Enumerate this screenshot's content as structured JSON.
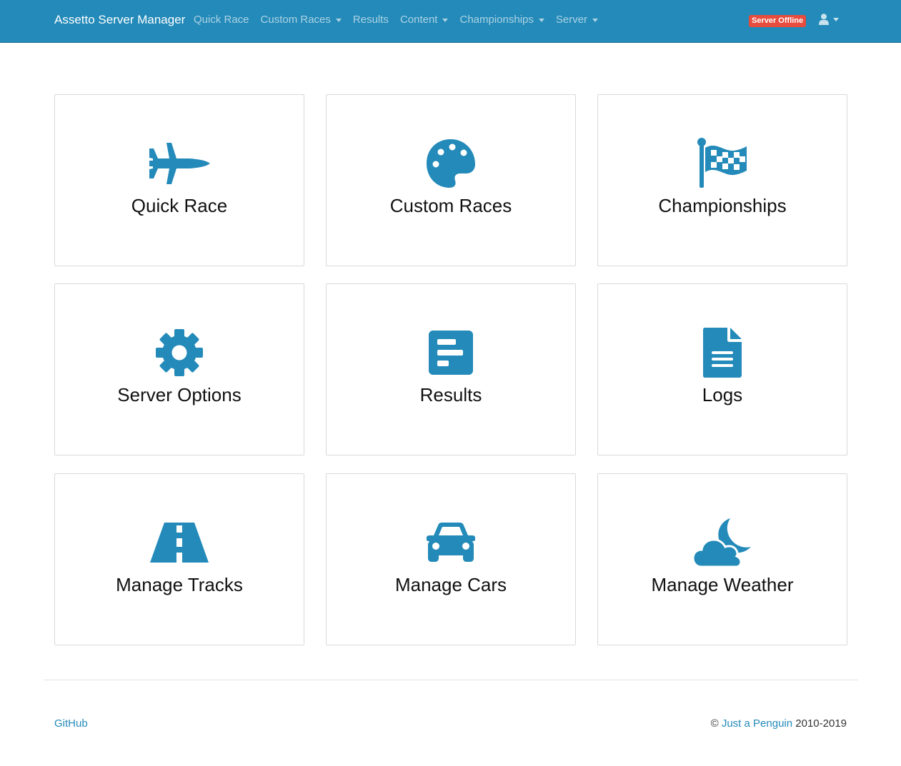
{
  "navbar": {
    "brand": "Assetto Server Manager",
    "links": [
      {
        "label": "Quick Race",
        "dropdown": false
      },
      {
        "label": "Custom Races",
        "dropdown": true
      },
      {
        "label": "Results",
        "dropdown": false
      },
      {
        "label": "Content",
        "dropdown": true
      },
      {
        "label": "Championships",
        "dropdown": true
      },
      {
        "label": "Server",
        "dropdown": true
      }
    ],
    "status_badge": "Server Offline",
    "status_color": "#e74c3c",
    "user_icon": "user-icon"
  },
  "cards": [
    {
      "label": "Quick Race",
      "icon": "fighter-jet-icon"
    },
    {
      "label": "Custom Races",
      "icon": "palette-icon"
    },
    {
      "label": "Championships",
      "icon": "checkered-flag-icon"
    },
    {
      "label": "Server Options",
      "icon": "gear-icon"
    },
    {
      "label": "Results",
      "icon": "poll-icon"
    },
    {
      "label": "Logs",
      "icon": "file-alt-icon"
    },
    {
      "label": "Manage Tracks",
      "icon": "road-icon"
    },
    {
      "label": "Manage Cars",
      "icon": "car-icon"
    },
    {
      "label": "Manage Weather",
      "icon": "cloud-moon-icon"
    }
  ],
  "footer": {
    "github": "GitHub",
    "copyright_symbol": "©",
    "author": "Just a Penguin",
    "years": "2010-2019"
  },
  "colors": {
    "accent": "#238ab9",
    "navbar": "#238ab9"
  }
}
